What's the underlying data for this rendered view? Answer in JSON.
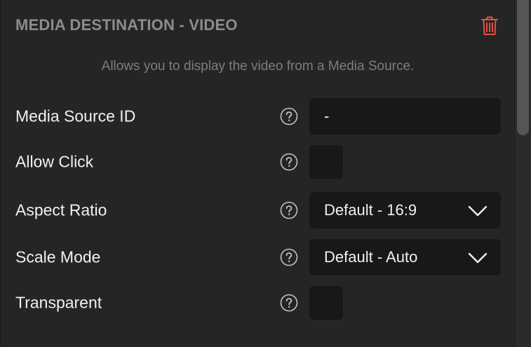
{
  "header": {
    "title": "MEDIA DESTINATION - VIDEO",
    "delete_icon": "trash-icon",
    "delete_color": "#e0524a"
  },
  "description": "Allows you to display the video from a Media Source.",
  "fields": {
    "media_source_id": {
      "label": "Media Source ID",
      "value": "-",
      "help_icon": "help-circle-icon"
    },
    "allow_click": {
      "label": "Allow Click",
      "checked": false,
      "help_icon": "help-circle-icon"
    },
    "aspect_ratio": {
      "label": "Aspect Ratio",
      "selected": "Default - 16:9",
      "help_icon": "help-circle-icon"
    },
    "scale_mode": {
      "label": "Scale Mode",
      "selected": "Default - Auto",
      "help_icon": "help-circle-icon"
    },
    "transparent": {
      "label": "Transparent",
      "checked": false,
      "help_icon": "help-circle-icon"
    }
  },
  "colors": {
    "panel_bg": "#252526",
    "control_bg": "#181818",
    "text": "#f0f0f0",
    "muted_text": "#8c8c8c"
  }
}
